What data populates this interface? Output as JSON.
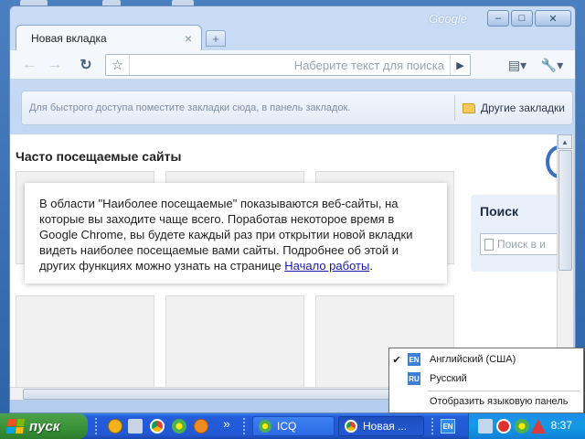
{
  "window": {
    "brand": "Google",
    "minimize_glyph": "–",
    "maximize_glyph": "□",
    "close_glyph": "✕"
  },
  "tab": {
    "title": "Новая вкладка",
    "close_glyph": "×",
    "new_tab_glyph": "+"
  },
  "toolbar": {
    "back_glyph": "←",
    "forward_glyph": "→",
    "reload_glyph": "↻",
    "star_glyph": "☆",
    "omnibox_placeholder": "Наберите текст для поиска",
    "go_glyph": "▶",
    "page_menu_glyph": "▤▾",
    "wrench_glyph": "🔧▾"
  },
  "bookmarks": {
    "hint": "Для быстрого доступа поместите закладки сюда, в панель закладок.",
    "other_label": "Другие закладки"
  },
  "newtab": {
    "most_visited_title": "Часто посещаемые сайты",
    "info_text": "В области \"Наиболее посещаемые\" показываются веб-сайты, на которые вы заходите чаще всего. Поработав некоторое время в Google Chrome, вы будете каждый раз при открытии новой вкладки видеть наиболее посещаемые вами сайты. Подробнее об этой и других функциях можно узнать на странице ",
    "info_link": "Начало работы",
    "info_end": ".",
    "search_title": "Поиск",
    "search_placeholder": "Поиск в и"
  },
  "language_menu": {
    "items": [
      {
        "code": "EN",
        "label": "Английский (США)",
        "checked": true
      },
      {
        "code": "RU",
        "label": "Русский",
        "checked": false
      }
    ],
    "check_glyph": "✔",
    "show_bar_label": "Отобразить языковую панель"
  },
  "taskbar": {
    "start_label": "пуск",
    "overflow_glyph": "»",
    "tasks": [
      {
        "label": "ICQ"
      },
      {
        "label": "Новая ..."
      }
    ],
    "lang_indicator": "EN",
    "clock": "8:37"
  },
  "colors": {
    "taskbar_blue": "#245edc",
    "start_green": "#379137",
    "tray_blue": "#139ae6",
    "link_blue": "#1a1aa6"
  },
  "icons": [
    "back-arrow-icon",
    "forward-arrow-icon",
    "reload-icon",
    "star-icon",
    "go-icon",
    "page-menu-icon",
    "wrench-icon",
    "folder-icon",
    "google-logo-icon",
    "document-icon",
    "windows-flag-icon",
    "icq-icon",
    "chrome-icon"
  ]
}
